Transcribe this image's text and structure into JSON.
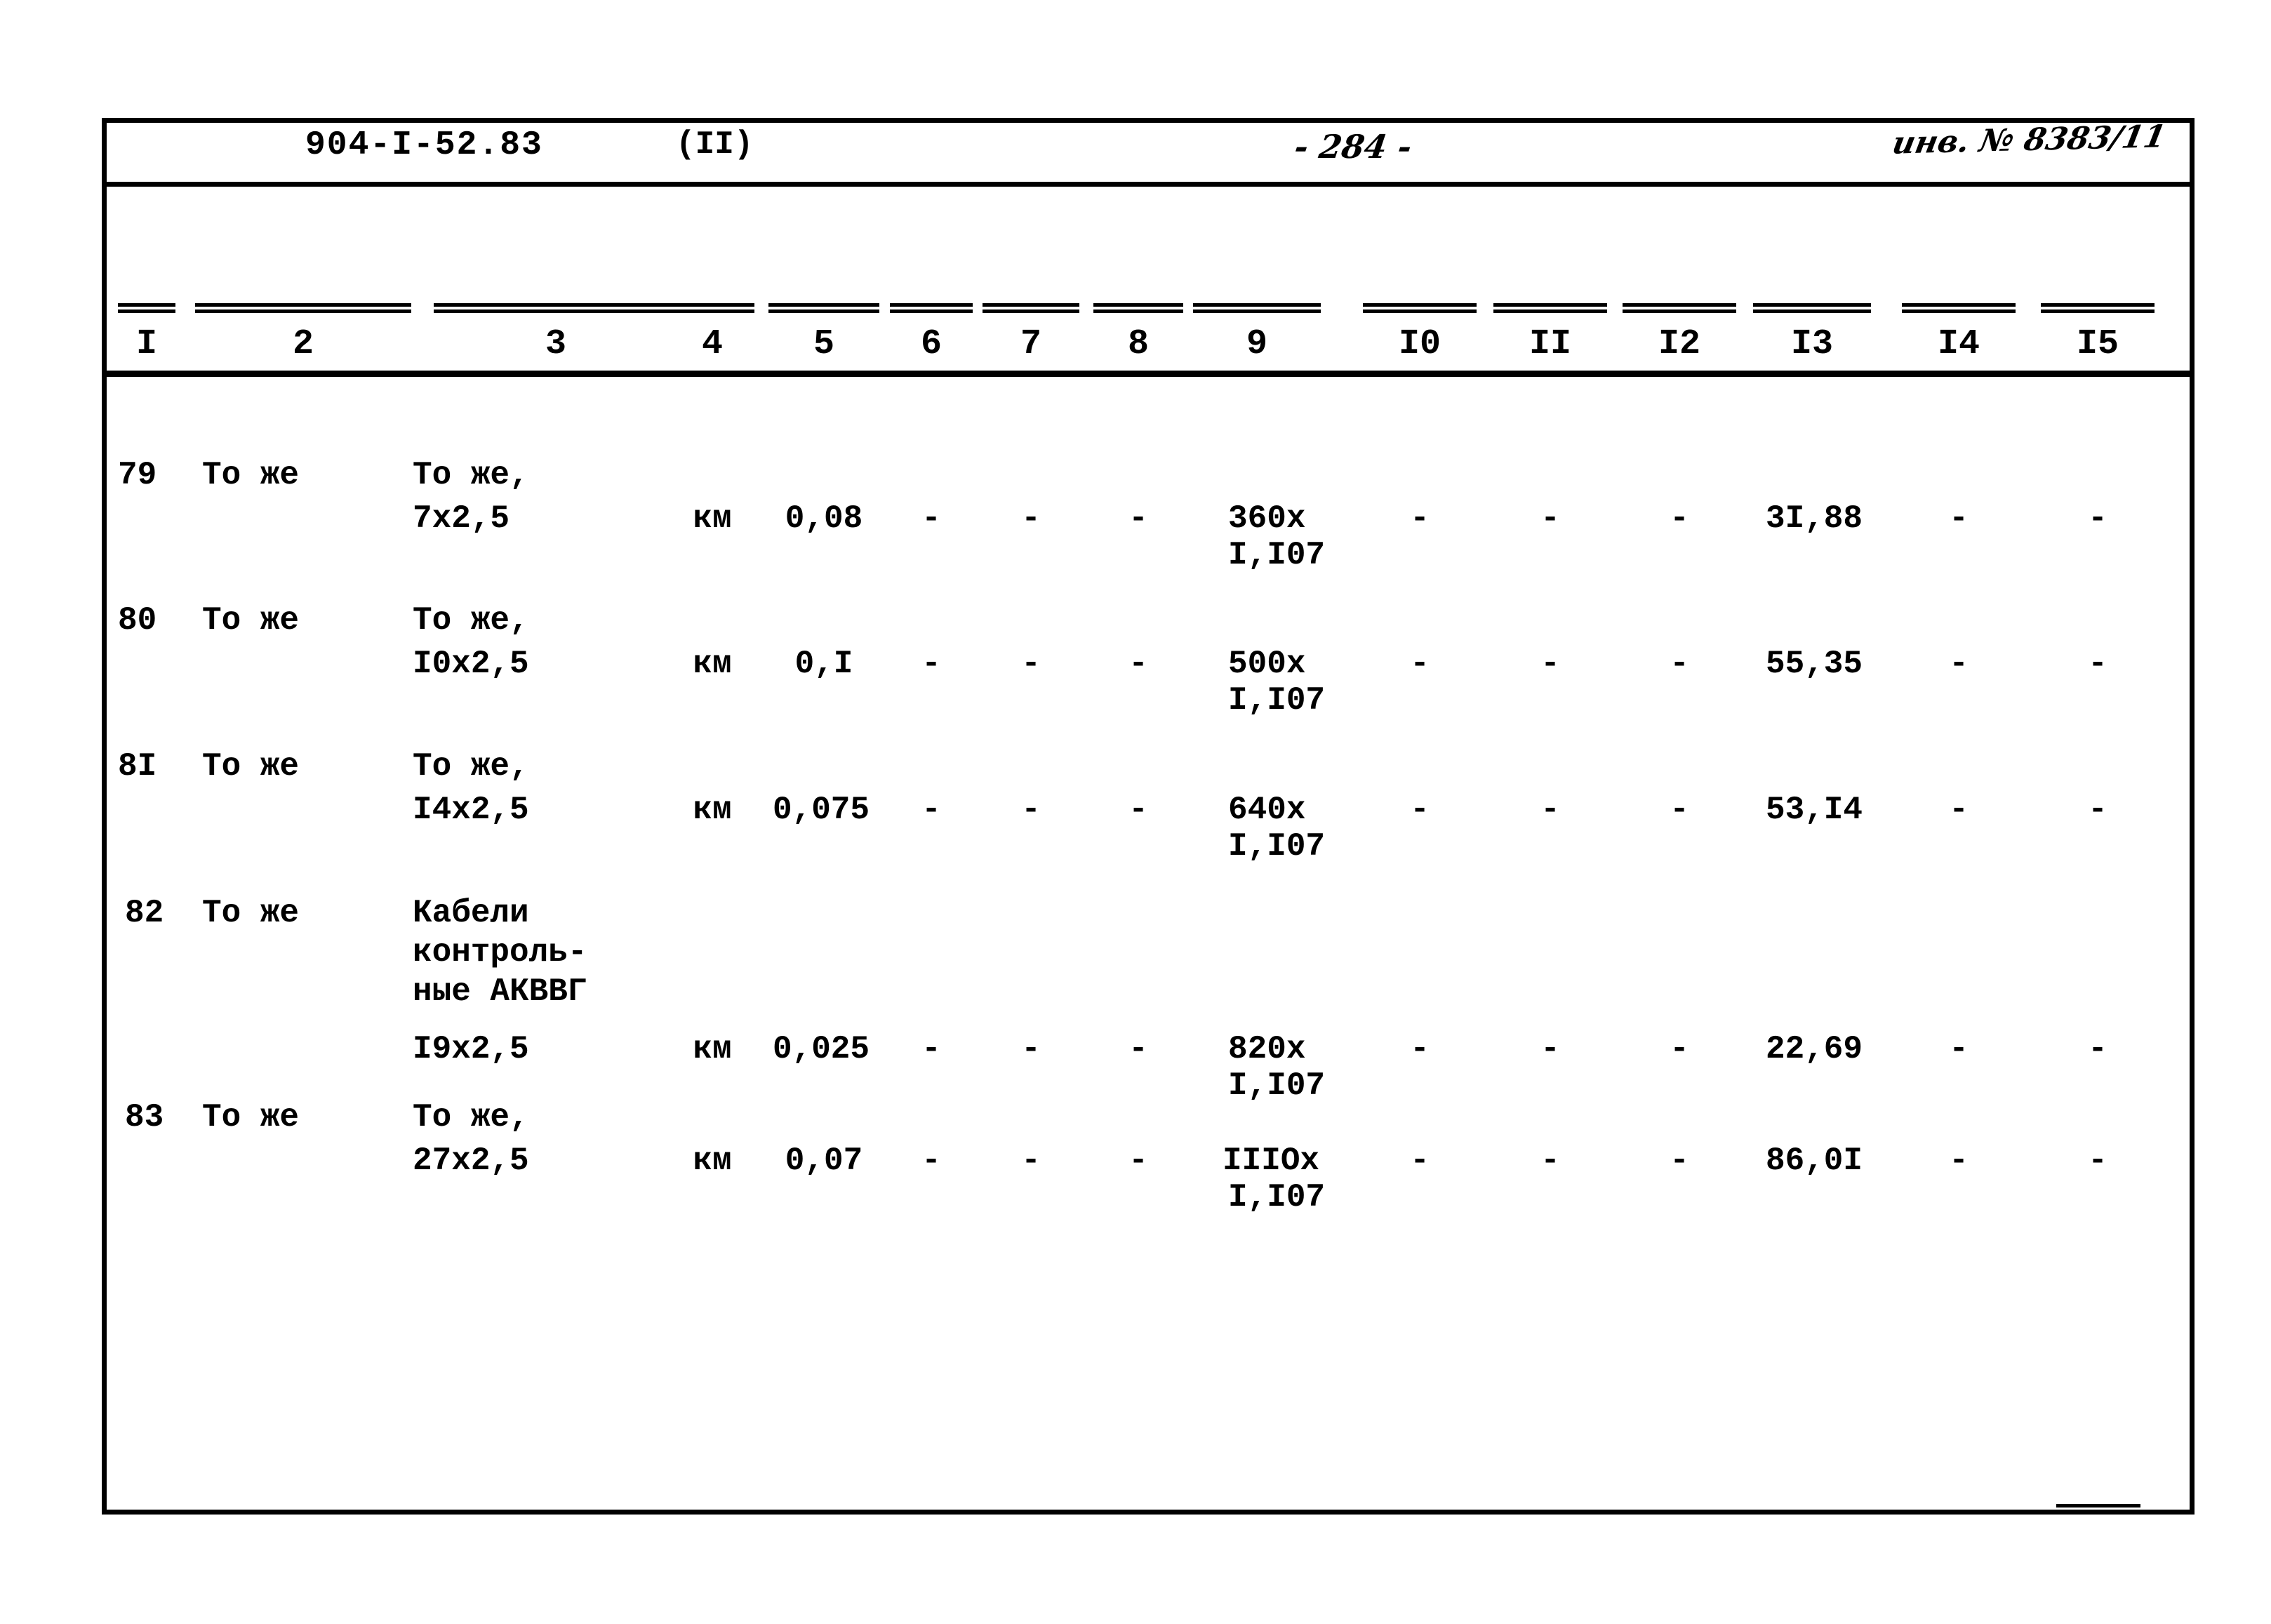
{
  "document": {
    "series_code": "904-I-52.83",
    "part": "(II)",
    "page_number": "- 284 -",
    "inventory_number": "инв. № 8383/11"
  },
  "table": {
    "column_numbers": [
      "I",
      "2",
      "3",
      "4",
      "5",
      "6",
      "7",
      "8",
      "9",
      "I0",
      "II",
      "I2",
      "I3",
      "I4",
      "I5"
    ],
    "rows": [
      {
        "num": "79",
        "col2": "То же",
        "col3_line1": "То же,",
        "col3_line2": "7х2,5",
        "col3_line3": "",
        "unit": "км",
        "qty": "0,08",
        "col6": "-",
        "col7": "-",
        "col8": "-",
        "col9_top": "360х",
        "col9_bottom": "I,I07",
        "col10": "-",
        "col11": "-",
        "col12": "-",
        "col13": "3I,88",
        "col14": "-",
        "col15": "-"
      },
      {
        "num": "80",
        "col2": "То же",
        "col3_line1": "То же,",
        "col3_line2": "I0х2,5",
        "col3_line3": "",
        "unit": "км",
        "qty": "0,I",
        "col6": "-",
        "col7": "-",
        "col8": "-",
        "col9_top": "500х",
        "col9_bottom": "I,I07",
        "col10": "-",
        "col11": "-",
        "col12": "-",
        "col13": "55,35",
        "col14": "-",
        "col15": "-"
      },
      {
        "num": "8I",
        "col2": "То же",
        "col3_line1": "То же,",
        "col3_line2": "I4х2,5",
        "col3_line3": "",
        "unit": "км",
        "qty": "0,075",
        "col6": "-",
        "col7": "-",
        "col8": "-",
        "col9_top": "640х",
        "col9_bottom": "I,I07",
        "col10": "-",
        "col11": "-",
        "col12": "-",
        "col13": "53,I4",
        "col14": "-",
        "col15": "-"
      },
      {
        "num": "82",
        "col2": "То же",
        "col3_line1": "Кабели",
        "col3_line2": "контроль-",
        "col3_line3": "ные АКВВГ",
        "col3_line4": "I9х2,5",
        "unit": "км",
        "qty": "0,025",
        "col6": "-",
        "col7": "-",
        "col8": "-",
        "col9_top": "820х",
        "col9_bottom": "I,I07",
        "col10": "-",
        "col11": "-",
        "col12": "-",
        "col13": "22,69",
        "col14": "-",
        "col15": "-"
      },
      {
        "num": "83",
        "col2": "То же",
        "col3_line1": "То же,",
        "col3_line2": "27х2,5",
        "col3_line3": "",
        "unit": "км",
        "qty": "0,07",
        "col6": "-",
        "col7": "-",
        "col8": "-",
        "col9_top": "IIIOх",
        "col9_bottom": "I,I07",
        "col10": "-",
        "col11": "-",
        "col12": "-",
        "col13": "86,0I",
        "col14": "-",
        "col15": "-"
      }
    ]
  }
}
